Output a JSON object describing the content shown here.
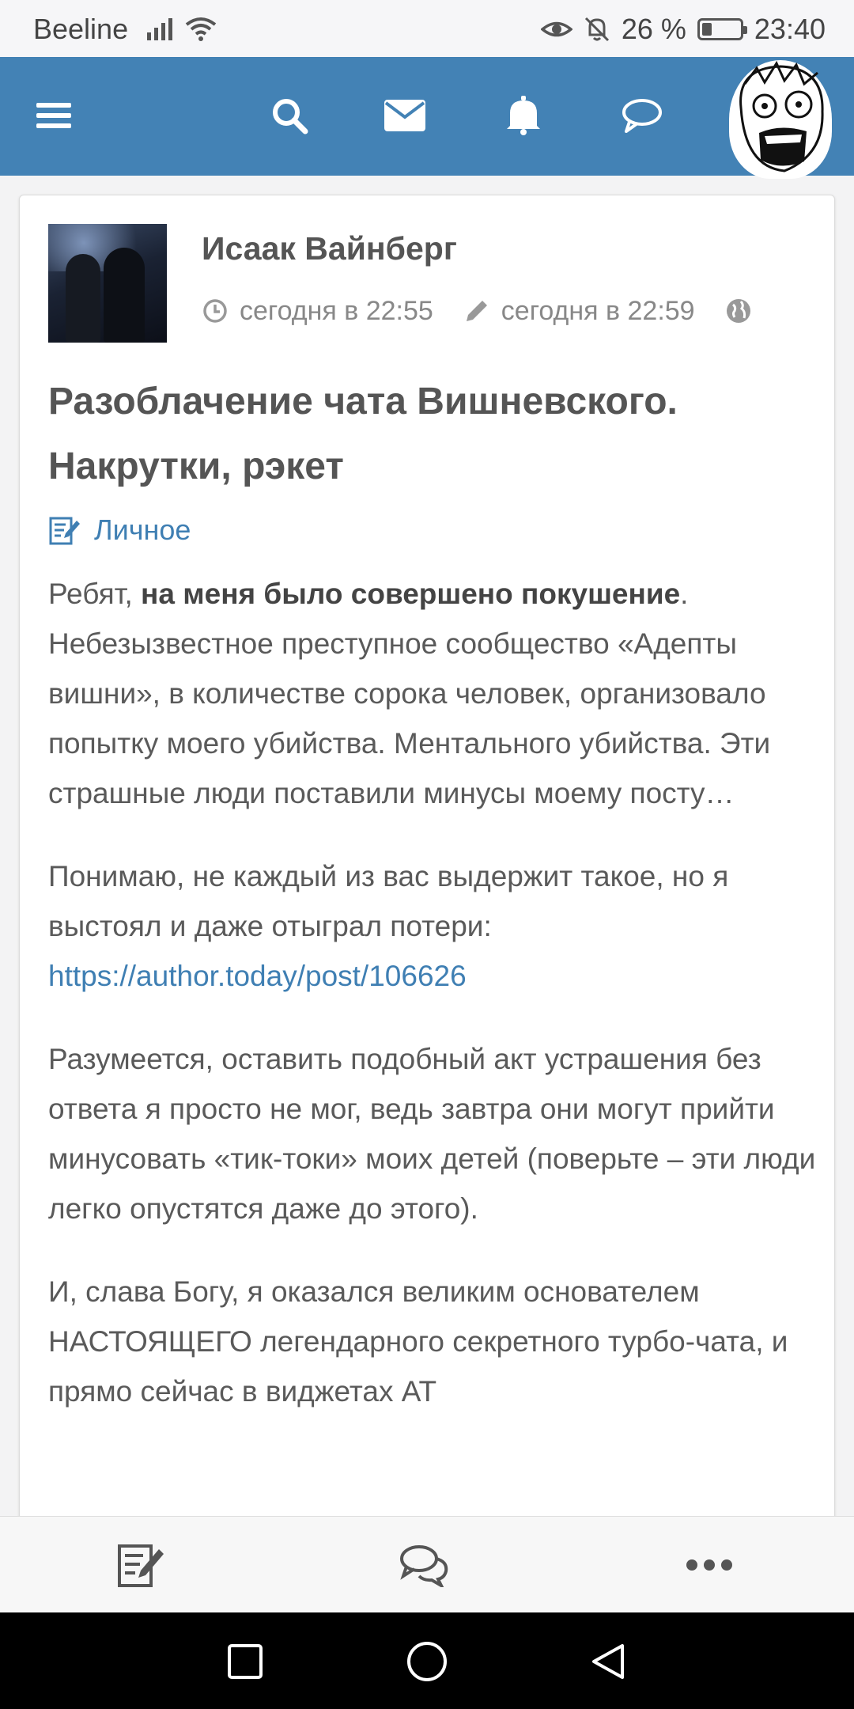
{
  "status_bar": {
    "carrier": "Beeline",
    "battery_percent": "26 %",
    "battery_level": 0.26,
    "time": "23:40",
    "icons": [
      "signal-icon",
      "wifi-icon",
      "eye-icon",
      "mute-bell-icon",
      "battery-icon"
    ]
  },
  "app_bar": {
    "icons": [
      "menu-icon",
      "search-icon",
      "mail-icon",
      "bell-icon",
      "chat-icon",
      "user-avatar"
    ],
    "colors": {
      "background": "#4382b5",
      "icon": "#ffffff"
    }
  },
  "post": {
    "author": "Исаак Вайнберг",
    "published": "сегодня в 22:55",
    "edited": "сегодня в 22:59",
    "title_line1": "Разоблачение чата Вишневского.",
    "title_line2": "Накрутки, рэкет",
    "category": "Личное",
    "p1_prefix": "Ребят, ",
    "p1_bold": "на меня было совершено покушение",
    "p1_rest": ". Небезызвестное преступное сообщество «Адепты вишни», в количестве сорока человек, организовало попытку моего убийства. Ментального убийства. Эти страшные люди поставили минусы моему посту…",
    "p2_text": "Понимаю, не каждый из вас выдержит такое, но я выстоял и даже отыграл потери: ",
    "p2_link": "https://author.today/post/106626",
    "p3": "Разумеется, оставить подобный акт устрашения без ответа я просто не мог, ведь завтра они могут прийти минусовать «тик-токи» моих детей (поверьте – эти люди легко опустятся даже до этого).",
    "p4": "И, слава Богу, я оказался великим основателем НАСТОЯЩЕГО легендарного секретного турбо-чата, и прямо сейчас в виджетах АТ",
    "colors": {
      "link": "#3f7fb3",
      "text": "#5a5a5a"
    }
  },
  "action_bar": {
    "icons": [
      "edit-note-icon",
      "comments-icon",
      "more-icon"
    ]
  },
  "nav_bar": {
    "icons": [
      "recent-apps-icon",
      "home-icon",
      "back-icon"
    ]
  }
}
